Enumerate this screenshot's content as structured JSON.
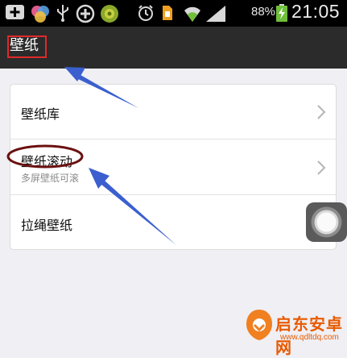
{
  "status_bar": {
    "battery_percent": "88%",
    "time": "21:05",
    "icons": [
      "add-icon",
      "media-icon",
      "usb-icon",
      "add-circle-icon",
      "app-icon",
      "alarm-icon",
      "sim-icon",
      "wifi-icon",
      "signal-icon",
      "battery-charging-icon"
    ]
  },
  "header": {
    "title": "壁纸"
  },
  "settings": {
    "items": [
      {
        "label": "壁纸库",
        "has_chevron": true
      },
      {
        "label": "壁纸滚动",
        "sublabel": "多屏壁纸可滚",
        "has_chevron": true
      },
      {
        "label": "拉绳壁纸",
        "has_chevron": false
      }
    ]
  },
  "watermark": {
    "title": "启东安卓网",
    "url": "www.qdltdq.com"
  },
  "colors": {
    "header_bg": "#2b2b2b",
    "highlight_red": "#e0292a",
    "annotation_blue": "#3b5fcf",
    "ellipse_maroon": "#6b1010",
    "watermark_orange": "#e85a00"
  }
}
